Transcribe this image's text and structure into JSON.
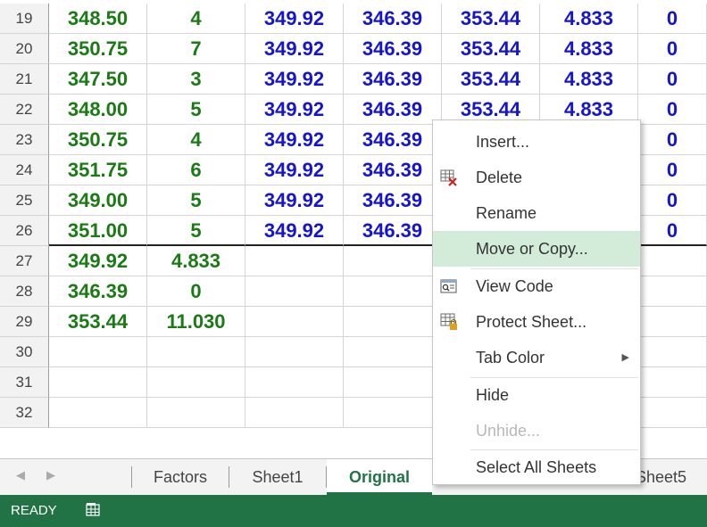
{
  "rows": [
    {
      "num": "19",
      "a": "348.50",
      "b": "4",
      "c": "349.92",
      "d": "346.39",
      "e": "353.44",
      "f": "4.833",
      "g": "0"
    },
    {
      "num": "20",
      "a": "350.75",
      "b": "7",
      "c": "349.92",
      "d": "346.39",
      "e": "353.44",
      "f": "4.833",
      "g": "0"
    },
    {
      "num": "21",
      "a": "347.50",
      "b": "3",
      "c": "349.92",
      "d": "346.39",
      "e": "353.44",
      "f": "4.833",
      "g": "0"
    },
    {
      "num": "22",
      "a": "348.00",
      "b": "5",
      "c": "349.92",
      "d": "346.39",
      "e": "353.44",
      "f": "4.833",
      "g": "0"
    },
    {
      "num": "23",
      "a": "350.75",
      "b": "4",
      "c": "349.92",
      "d": "346.39",
      "e": "",
      "f": "",
      "g": "0"
    },
    {
      "num": "24",
      "a": "351.75",
      "b": "6",
      "c": "349.92",
      "d": "346.39",
      "e": "",
      "f": "",
      "g": "0"
    },
    {
      "num": "25",
      "a": "349.00",
      "b": "5",
      "c": "349.92",
      "d": "346.39",
      "e": "",
      "f": "",
      "g": "0"
    },
    {
      "num": "26",
      "a": "351.00",
      "b": "5",
      "c": "349.92",
      "d": "346.39",
      "e": "",
      "f": "",
      "g": "0"
    },
    {
      "num": "27",
      "a": "349.92",
      "b": "4.833",
      "c": "",
      "d": "",
      "e": "",
      "f": "",
      "g": ""
    },
    {
      "num": "28",
      "a": "346.39",
      "b": "0",
      "c": "",
      "d": "",
      "e": "",
      "f": "",
      "g": ""
    },
    {
      "num": "29",
      "a": "353.44",
      "b": "11.030",
      "c": "",
      "d": "",
      "e": "",
      "f": "",
      "g": ""
    },
    {
      "num": "30",
      "a": "",
      "b": "",
      "c": "",
      "d": "",
      "e": "",
      "f": "",
      "g": ""
    },
    {
      "num": "31",
      "a": "",
      "b": "",
      "c": "",
      "d": "",
      "e": "",
      "f": "",
      "g": ""
    },
    {
      "num": "32",
      "a": "",
      "b": "",
      "c": "",
      "d": "",
      "e": "",
      "f": "",
      "g": ""
    }
  ],
  "tabs": {
    "prev_icon": "◀",
    "next_icon": "▶",
    "factors": "Factors",
    "sheet1": "Sheet1",
    "original": "Original",
    "sheet5": "Sheet5"
  },
  "status": {
    "text": "READY"
  },
  "menu": {
    "insert": "Insert...",
    "delete": "Delete",
    "rename": "Rename",
    "move_copy": "Move or Copy...",
    "view_code": "View Code",
    "protect": "Protect Sheet...",
    "tab_color": "Tab Color",
    "hide": "Hide",
    "unhide": "Unhide...",
    "select_all": "Select All Sheets"
  },
  "colors": {
    "green_text": "#1a7a14",
    "blue_text": "#1414d2",
    "accent": "#217346",
    "hover": "#d3ecd9"
  }
}
